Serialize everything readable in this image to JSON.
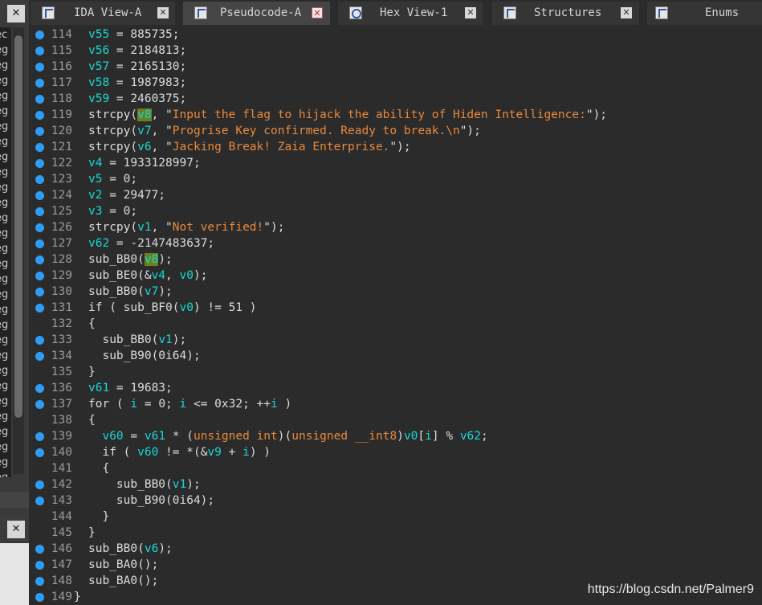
{
  "left_panel": {
    "close_symbol": "✕",
    "rows": [
      "ec",
      "eg",
      "eg",
      "eg",
      "eg",
      "eg",
      "eg",
      "eg",
      "eg",
      "eg",
      "eg",
      "eg",
      "eg",
      "eg",
      "eg",
      "eg",
      "eg",
      "eg",
      "eg",
      "eg",
      "eg",
      "eg",
      "eg",
      "eg",
      "eg",
      "eg",
      "eg",
      "eg",
      "eg",
      "eg"
    ]
  },
  "tabs": [
    {
      "label": "IDA View-A",
      "icon": "ida-view-icon",
      "active": false
    },
    {
      "label": "Pseudocode-A",
      "icon": "pseudocode-icon",
      "active": true
    },
    {
      "label": "Hex View-1",
      "icon": "hex-view-icon",
      "active": false
    },
    {
      "label": "Structures",
      "icon": "structures-icon",
      "active": false
    },
    {
      "label": "Enums",
      "icon": "enums-icon",
      "active": false
    }
  ],
  "code_lines": [
    {
      "n": "114",
      "dot": true,
      "t": "v55 = 885735;"
    },
    {
      "n": "115",
      "dot": true,
      "t": "v56 = 2184813;"
    },
    {
      "n": "116",
      "dot": true,
      "t": "v57 = 2165130;"
    },
    {
      "n": "117",
      "dot": true,
      "t": "v58 = 1987983;"
    },
    {
      "n": "118",
      "dot": true,
      "t": "v59 = 2460375;"
    },
    {
      "n": "119",
      "dot": true,
      "t": "strcpy(v8, \"Input the flag to hijack the ability of Hiden Intelligence:\");"
    },
    {
      "n": "120",
      "dot": true,
      "t": "strcpy(v7, \"Progrise Key confirmed. Ready to break.\\n\");"
    },
    {
      "n": "121",
      "dot": true,
      "t": "strcpy(v6, \"Jacking Break! Zaia Enterprise.\");"
    },
    {
      "n": "122",
      "dot": true,
      "t": "v4 = 1933128997;"
    },
    {
      "n": "123",
      "dot": true,
      "t": "v5 = 0;"
    },
    {
      "n": "124",
      "dot": true,
      "t": "v2 = 29477;"
    },
    {
      "n": "125",
      "dot": true,
      "t": "v3 = 0;"
    },
    {
      "n": "126",
      "dot": true,
      "t": "strcpy(v1, \"Not verified!\");"
    },
    {
      "n": "127",
      "dot": true,
      "t": "v62 = -2147483637;"
    },
    {
      "n": "128",
      "dot": true,
      "t": "sub_BB0(v8);"
    },
    {
      "n": "129",
      "dot": true,
      "t": "sub_BE0(&v4, v0);"
    },
    {
      "n": "130",
      "dot": true,
      "t": "sub_BB0(v7);"
    },
    {
      "n": "131",
      "dot": true,
      "t": "if ( sub_BF0(v0) != 51 )"
    },
    {
      "n": "132",
      "dot": false,
      "t": "{"
    },
    {
      "n": "133",
      "dot": true,
      "t": "  sub_BB0(v1);"
    },
    {
      "n": "134",
      "dot": true,
      "t": "  sub_B90(0i64);"
    },
    {
      "n": "135",
      "dot": false,
      "t": "}"
    },
    {
      "n": "136",
      "dot": true,
      "t": "v61 = 19683;"
    },
    {
      "n": "137",
      "dot": true,
      "t": "for ( i = 0; i <= 0x32; ++i )"
    },
    {
      "n": "138",
      "dot": false,
      "t": "{"
    },
    {
      "n": "139",
      "dot": true,
      "t": "  v60 = v61 * (unsigned int)(unsigned __int8)v0[i] % v62;"
    },
    {
      "n": "140",
      "dot": true,
      "t": "  if ( v60 != *(&v9 + i) )"
    },
    {
      "n": "141",
      "dot": false,
      "t": "  {"
    },
    {
      "n": "142",
      "dot": true,
      "t": "    sub_BB0(v1);"
    },
    {
      "n": "143",
      "dot": true,
      "t": "    sub_B90(0i64);"
    },
    {
      "n": "144",
      "dot": false,
      "t": "  }"
    },
    {
      "n": "145",
      "dot": false,
      "t": "}"
    },
    {
      "n": "146",
      "dot": true,
      "t": "sub_BB0(v6);"
    },
    {
      "n": "147",
      "dot": true,
      "t": "sub_BA0();"
    },
    {
      "n": "148",
      "dot": true,
      "t": "sub_BA0();"
    },
    {
      "n": "149",
      "dot": true,
      "t": "}"
    }
  ],
  "colors": {
    "variable": "#18d8d8",
    "string": "#e8893c",
    "highlight": "#6a7f1f",
    "breakpoint_dot": "#2f9cf5"
  },
  "highlighted_variable": "v8",
  "watermark": "https://blog.csdn.net/Palmer9"
}
